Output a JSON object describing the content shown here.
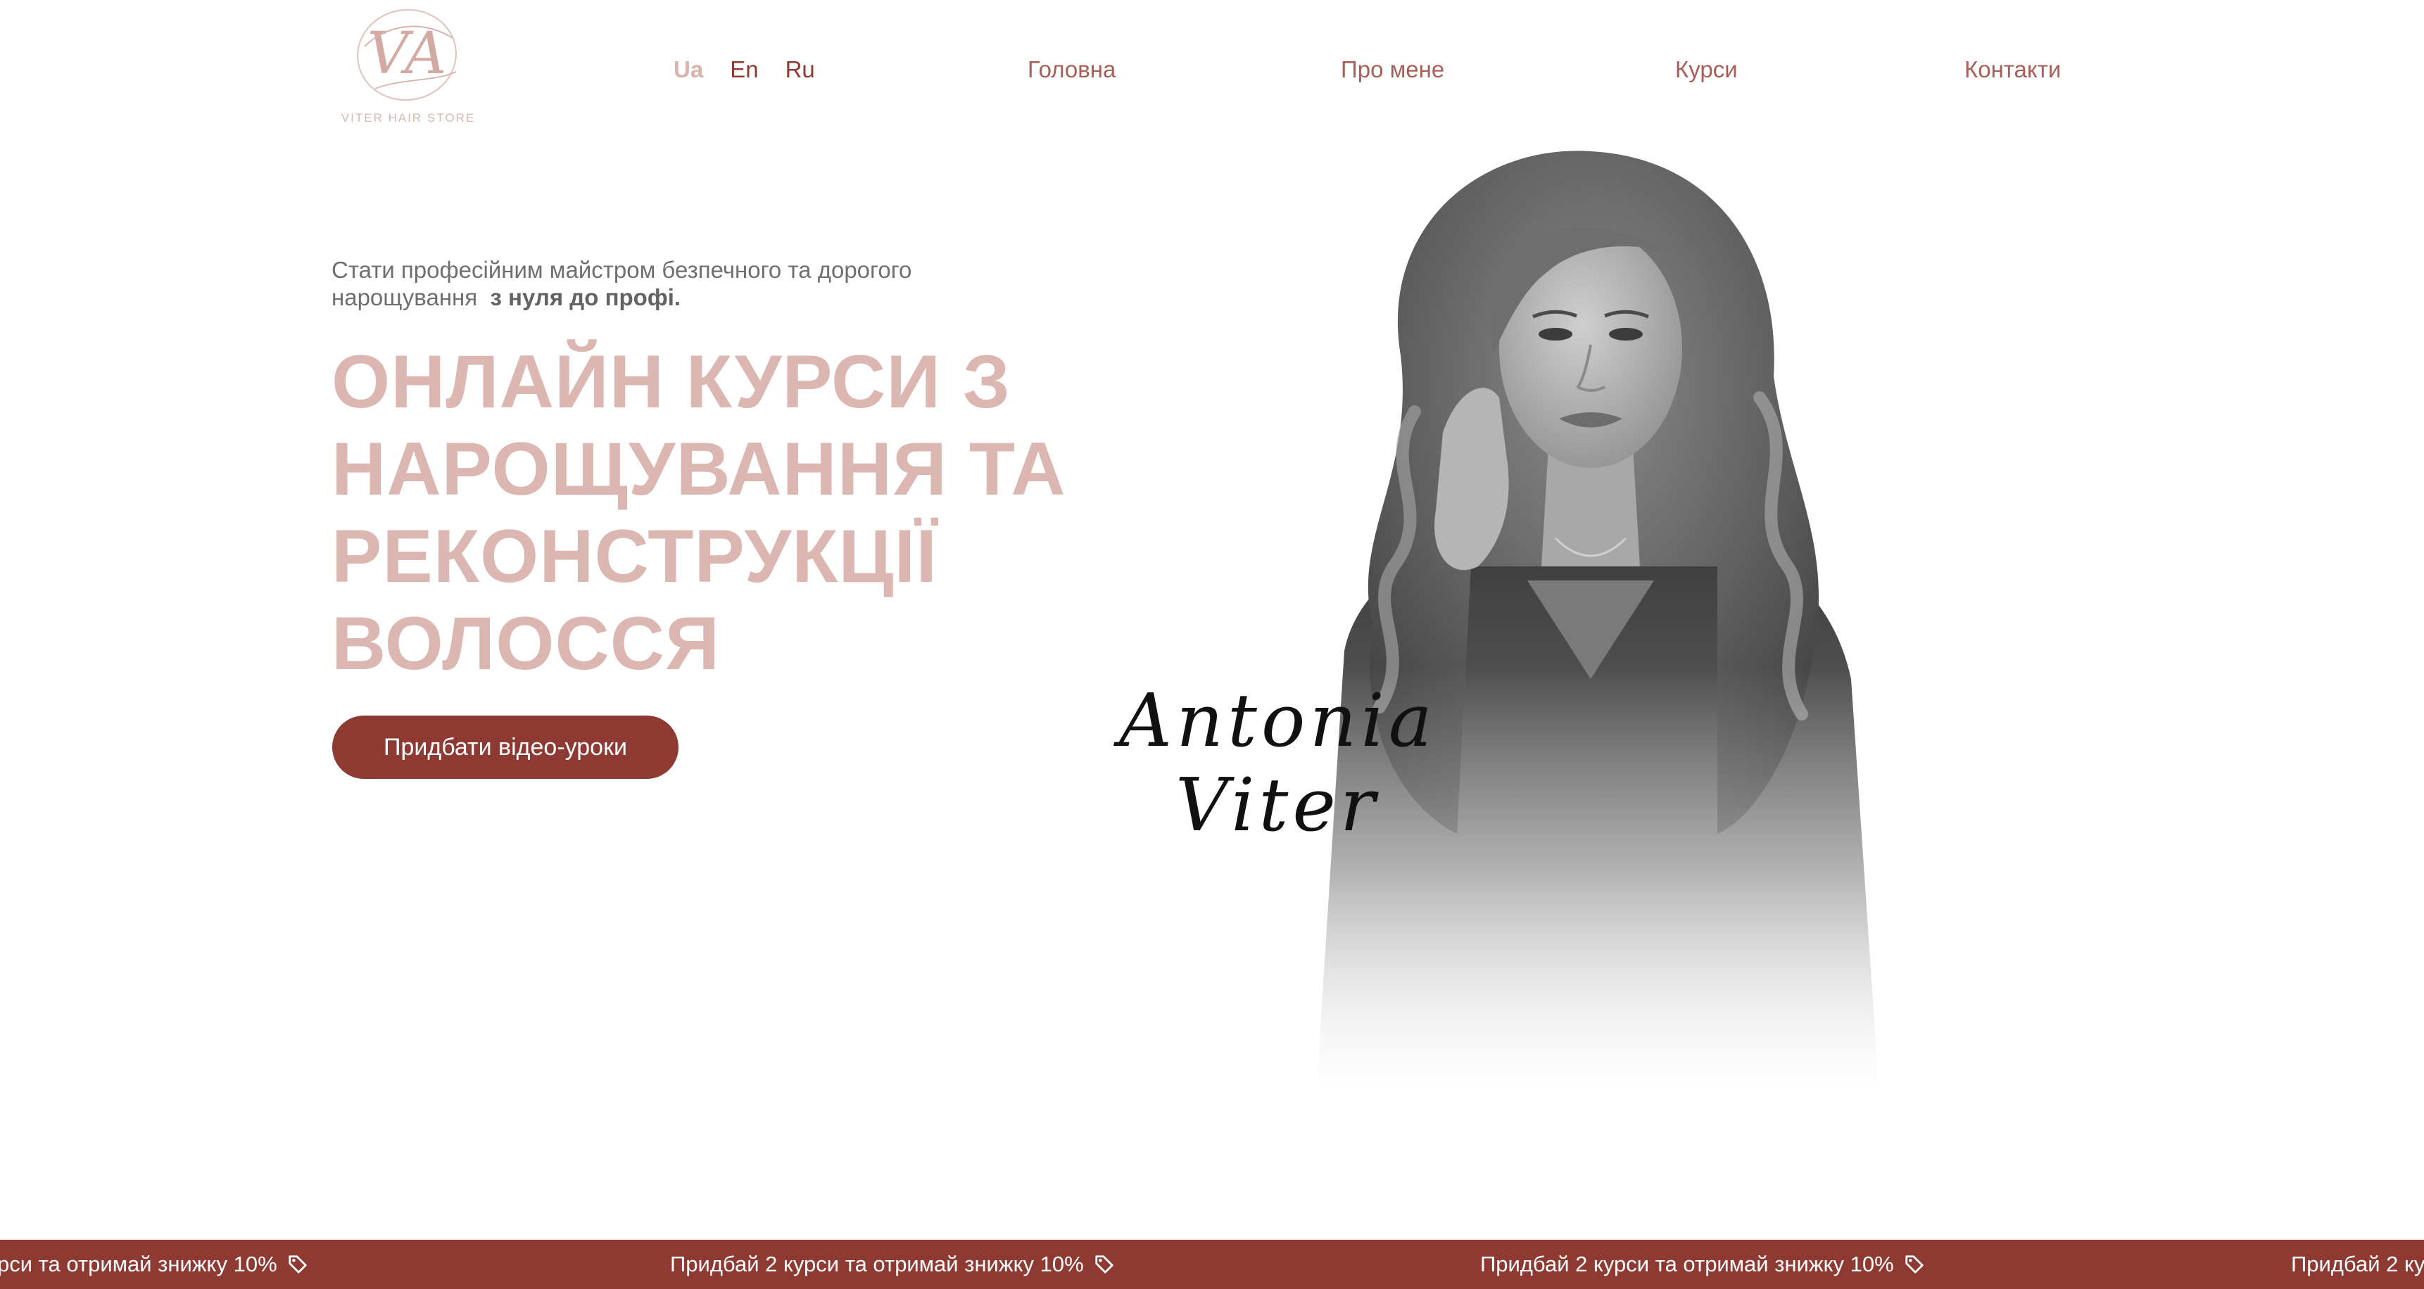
{
  "logo": {
    "monogram": "VA",
    "text": "VITER HAIR STORE"
  },
  "languages": [
    {
      "label": "Ua",
      "active": true
    },
    {
      "label": "En",
      "active": false
    },
    {
      "label": "Ru",
      "active": false
    }
  ],
  "nav": {
    "home": "Головна",
    "about": "Про мене",
    "courses": "Курси",
    "contacts": "Контакти"
  },
  "hero": {
    "subtitle": "Стати професійним майстром безпечного та дорогого нарощування",
    "subtitle_bold": "з нуля до профі.",
    "title_lines": [
      "ОНЛАЙН КУРСИ З",
      "НАРОЩУВАННЯ ТА",
      "РЕКОНСТРУКЦІЇ",
      "ВОЛОССЯ"
    ],
    "cta_label": "Придбати відео-уроки",
    "signature": [
      "Antonia",
      "Viter"
    ]
  },
  "promo": {
    "text_partial_left": "рси та отримай знижку 10%",
    "text": "Придбай 2 курси та отримай знижку 10%",
    "text_partial_right": "Придбай 2 ку",
    "icon": "tag-icon"
  },
  "colors": {
    "accent": "#8e3a33",
    "title": "#dcb6b1",
    "nav": "#a95f57",
    "logo": "#d8b7b2",
    "background": "#ffffff"
  }
}
